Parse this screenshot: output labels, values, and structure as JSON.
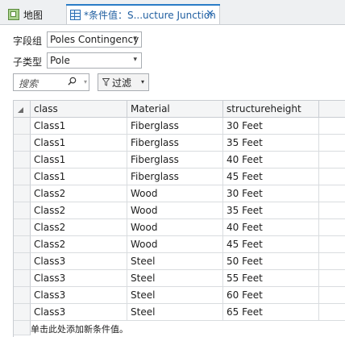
{
  "tabs": [
    {
      "label": "地图",
      "icon": "map-icon",
      "active": false
    },
    {
      "label": "*条件值：S...ucture Junction",
      "icon": "table-icon",
      "active": true
    }
  ],
  "form": {
    "field_group_label": "字段组",
    "field_group_value": "Poles Contingency",
    "subtype_label": "子类型",
    "subtype_value": "Pole"
  },
  "toolbar": {
    "search_placeholder": "搜索",
    "filter_label": "过滤"
  },
  "table": {
    "columns": [
      "class",
      "Material",
      "structureheight"
    ],
    "rows": [
      [
        "Class1",
        "Fiberglass",
        "30 Feet"
      ],
      [
        "Class1",
        "Fiberglass",
        "35 Feet"
      ],
      [
        "Class1",
        "Fiberglass",
        "40 Feet"
      ],
      [
        "Class1",
        "Fiberglass",
        "45 Feet"
      ],
      [
        "Class2",
        "Wood",
        "30 Feet"
      ],
      [
        "Class2",
        "Wood",
        "35 Feet"
      ],
      [
        "Class2",
        "Wood",
        "40 Feet"
      ],
      [
        "Class2",
        "Wood",
        "45 Feet"
      ],
      [
        "Class3",
        "Steel",
        "50 Feet"
      ],
      [
        "Class3",
        "Steel",
        "55 Feet"
      ],
      [
        "Class3",
        "Steel",
        "60 Feet"
      ],
      [
        "Class3",
        "Steel",
        "65 Feet"
      ]
    ],
    "add_row_text": "单击此处添加新条件值。"
  },
  "colors": {
    "accent": "#2a7cc7",
    "grid_line": "#d9dcdf",
    "header_bg": "#f4f5f6"
  }
}
